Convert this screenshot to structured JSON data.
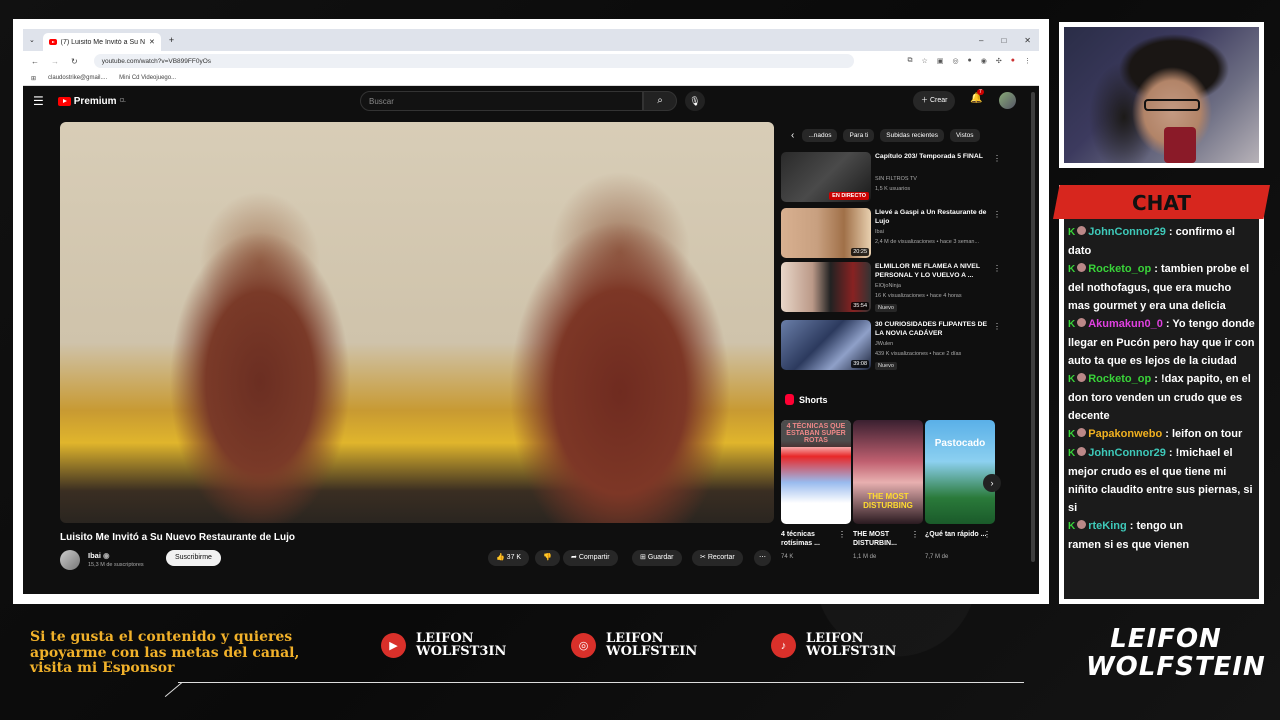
{
  "browser": {
    "tab_title": "(7) Luisito Me Invitó a Su Nue...",
    "new_tab": "+",
    "window_controls": [
      "–",
      "□",
      "✕"
    ],
    "url": "youtube.com/watch?v=VB899FF0yOs",
    "bookmarks": [
      "claudostrike@gmail....",
      "Mini Cd Videojuego..."
    ]
  },
  "youtube": {
    "logo": "Premium",
    "logo_region": "CL",
    "search_placeholder": "Buscar",
    "create_label": "Crear",
    "notification_count": "7",
    "video_title": "Luisito Me Invitó a Su Nuevo Restaurante de Lujo",
    "channel_name": "Ibai",
    "channel_subs": "15,3 M de suscriptores",
    "subscribe": "Suscribirme",
    "likes": "37 K",
    "share": "Compartir",
    "save": "Guardar",
    "clip": "Recortar",
    "chips": [
      "...nados",
      "Para ti",
      "Subidas recientes",
      "Vistos"
    ],
    "recommendations": [
      {
        "title": "Capítulo 203/ Temporada 5 FINAL",
        "channel": "SIN FILTROS TV",
        "meta": "1,5 K usuarios",
        "overlay": "EN DIRECTO",
        "badge": ""
      },
      {
        "title": "Llevé a Gaspi a Un Restaurante de Lujo",
        "channel": "Ibai",
        "meta": "2,4 M de visualizaciones • hace 3 seman...",
        "overlay": "20:25",
        "badge": ""
      },
      {
        "title": "ELMILLOR ME FLAMEA A NIVEL PERSONAL Y LO VUELVO A ...",
        "channel": "ElOjoNinja",
        "meta": "16 K visualizaciones • hace 4 horas",
        "overlay": "35:54",
        "badge": "Nuevo"
      },
      {
        "title": "30 CURIOSIDADES FLIPANTES DE LA NOVIA CADÁVER",
        "channel": "JWulen",
        "meta": "439 K visualizaciones • hace 2 días",
        "overlay": "39:08",
        "badge": "Nuevo"
      }
    ],
    "shorts_label": "Shorts",
    "shorts": [
      {
        "title": "4 técnicas rotísimas ...",
        "views": "74 K",
        "thumb_text": "4 TÉCNICAS QUE ESTABAN SUPER ROTAS"
      },
      {
        "title": "THE MOST DISTURBIN...",
        "views": "1,1 M de",
        "thumb_text": "THE MOST DISTURBING"
      },
      {
        "title": "¿Qué tan rápido ...",
        "views": "7,7 M de",
        "thumb_text": "Pastocado"
      }
    ]
  },
  "chat": {
    "header": "CHAT",
    "messages": [
      {
        "user": "JohnConnor29",
        "color": "#3ec9b9",
        "text": ": confirmo el dato"
      },
      {
        "user": "Rocketo_op",
        "color": "#39d339",
        "text": ": tambien probe el del nothofagus, que era mucho mas gourmet y era una delicia"
      },
      {
        "user": "Akumakun0_0",
        "color": "#e040e0",
        "text": ": Yo tengo donde llegar en Pucón pero hay que ir con auto ta que es lejos de la ciudad"
      },
      {
        "user": "Rocketo_op",
        "color": "#39d339",
        "text": ": !dax papito, en el don toro venden un crudo que es decente"
      },
      {
        "user": "Papakonwebo",
        "color": "#f0b020",
        "text": ": leifon on tour"
      },
      {
        "user": "JohnConnor29",
        "color": "#3ec9b9",
        "text": ": !michael el mejor crudo es el que tiene mi niñito claudito entre sus piernas, si si"
      },
      {
        "user": "rteKing",
        "color": "#3ec9b9",
        "text": ": tengo un"
      },
      {
        "user": "",
        "color": "#fff",
        "text": "ramen si es que vienen"
      }
    ]
  },
  "footer": {
    "sponsor_text": "Si te gusta el contenido y quieres apoyarme con las metas del canal, visita mi Esponsor",
    "socials": [
      {
        "icon": "youtube-icon",
        "line1": "LEIFON",
        "line2": "WOLFST3IN"
      },
      {
        "icon": "instagram-icon",
        "line1": "LEIFON",
        "line2": "WOLFSTEIN"
      },
      {
        "icon": "tiktok-icon",
        "line1": "LEIFON",
        "line2": "WOLFST3IN"
      }
    ],
    "brand_line1": "LEIFON",
    "brand_line2": "WOLFSTEIN"
  },
  "colors": {
    "accent_red": "#d7261e",
    "sponsor_gold": "#f1b12a"
  }
}
